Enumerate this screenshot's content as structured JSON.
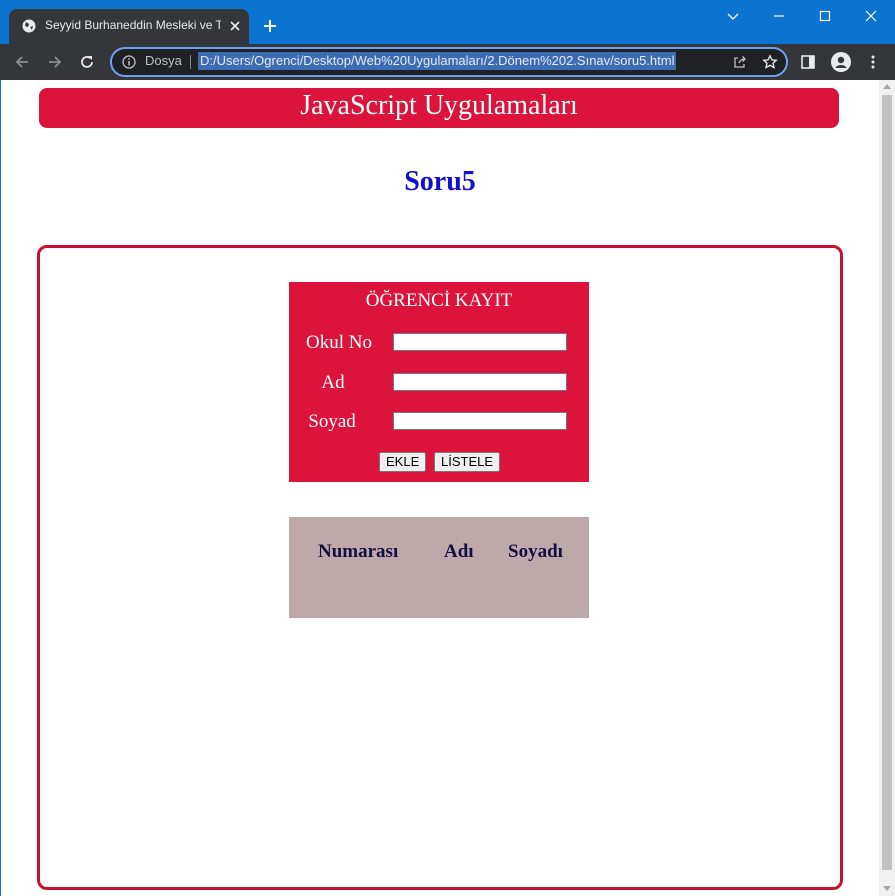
{
  "browser": {
    "tab_title": "Seyyid Burhaneddin Mesleki ve Teknik",
    "omnibox_label": "Dosya",
    "url": "D:/Users/Ogrenci/Desktop/Web%20Uygulamaları/2.Dönem%202.Sınav/soru5.html"
  },
  "page": {
    "banner": "JavaScript Uygulamaları",
    "heading": "Soru5",
    "form": {
      "title": "ÖĞRENCİ KAYIT",
      "fields": [
        {
          "label": "Okul No",
          "value": ""
        },
        {
          "label": "Ad",
          "value": ""
        },
        {
          "label": "Soyad",
          "value": ""
        }
      ],
      "add_button": "EKLE",
      "list_button": "LİSTELE"
    },
    "table": {
      "headers": [
        "Numarası",
        "Adı",
        "Soyadı"
      ]
    }
  },
  "colors": {
    "accent": "#dc143c",
    "heading": "#1010d0",
    "list_bg": "#bfa8aa",
    "chrome_blue": "#0b74d1"
  }
}
